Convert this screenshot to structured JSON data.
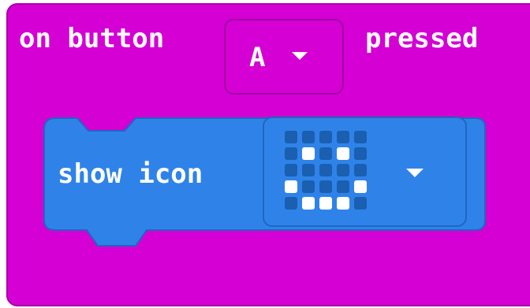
{
  "event_block": {
    "label_before": "on button",
    "button_value": "A",
    "label_after": "pressed",
    "color": "#d400d4"
  },
  "statement_block": {
    "label": "show icon",
    "color": "#2f83e8",
    "icon_name": "happy-face-icon",
    "led_pattern": [
      [
        0,
        0,
        0,
        0,
        0
      ],
      [
        0,
        1,
        0,
        1,
        0
      ],
      [
        0,
        0,
        0,
        0,
        0
      ],
      [
        1,
        0,
        0,
        0,
        1
      ],
      [
        0,
        1,
        1,
        1,
        0
      ]
    ]
  }
}
